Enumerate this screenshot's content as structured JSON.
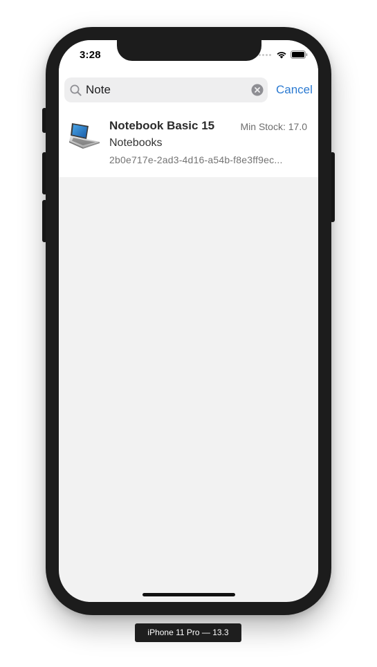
{
  "status_bar": {
    "time": "3:28",
    "wifi_icon": "wifi-icon",
    "battery_icon": "battery-icon"
  },
  "search": {
    "value": "Note",
    "search_icon": "magnifier-icon",
    "clear_icon": "clear-circle-icon",
    "cancel_label": "Cancel"
  },
  "results": [
    {
      "title": "Notebook Basic 15",
      "min_stock": "Min Stock: 17.0",
      "category": "Notebooks",
      "id": "2b0e717e-2ad3-4d16-a54b-f8e3ff9ec...",
      "thumbnail": "laptop-image"
    }
  ],
  "device_label": "iPhone 11 Pro — 13.3",
  "colors": {
    "accent": "#2b7ad1",
    "background": "#f2f2f2",
    "row_background": "#ffffff"
  }
}
